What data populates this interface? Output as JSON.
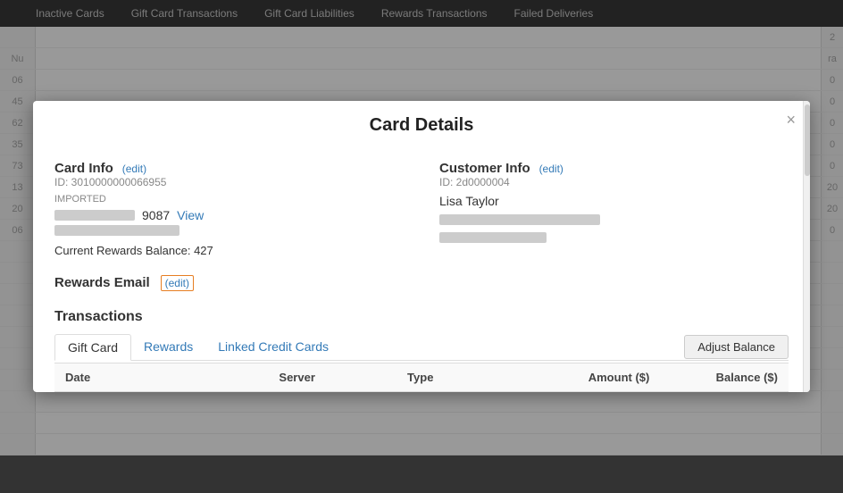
{
  "nav": {
    "items": [
      "Inactive Cards",
      "Gift Card Transactions",
      "Gift Card Liabilities",
      "Rewards Transactions",
      "Failed Deliveries"
    ]
  },
  "modal": {
    "title": "Card Details",
    "close_label": "×",
    "card_info": {
      "section_title": "Card Info",
      "edit_label": "(edit)",
      "id_label": "ID: 3010000000066955",
      "imported_label": "IMPORTED",
      "card_number_end": "9087",
      "view_label": "View",
      "rewards_balance_label": "Current Rewards Balance: 427"
    },
    "customer_info": {
      "section_title": "Customer Info",
      "edit_label": "(edit)",
      "id_label": "ID: 2d0000004",
      "customer_name": "Lisa Taylor"
    },
    "rewards_email": {
      "section_title": "Rewards Email",
      "edit_label": "(edit)"
    },
    "transactions": {
      "section_title": "Transactions",
      "tabs": [
        {
          "label": "Gift Card",
          "type": "gift"
        },
        {
          "label": "Rewards",
          "type": "link"
        },
        {
          "label": "Linked Credit Cards",
          "type": "link"
        }
      ],
      "adjust_balance_label": "Adjust Balance",
      "table_headers": [
        "Date",
        "Server",
        "Type",
        "Amount ($)",
        "Balance ($)"
      ]
    }
  },
  "bg_rows": [
    {
      "num": "",
      "right": "2"
    },
    {
      "num": "Nu",
      "right": "ra"
    },
    {
      "num": "06",
      "right": "0"
    },
    {
      "num": "45",
      "right": "0"
    },
    {
      "num": "62",
      "right": "0"
    },
    {
      "num": "35",
      "right": "0"
    },
    {
      "num": "73",
      "right": "0"
    },
    {
      "num": "13",
      "right": "20"
    },
    {
      "num": "20",
      "right": "20"
    },
    {
      "num": "06",
      "right": "0"
    },
    {
      "num": "",
      "right": ""
    },
    {
      "num": "",
      "right": ""
    },
    {
      "num": "",
      "right": ""
    },
    {
      "num": "",
      "right": ""
    },
    {
      "num": "",
      "right": ""
    },
    {
      "num": "",
      "right": ""
    },
    {
      "num": "",
      "right": ""
    },
    {
      "num": "",
      "right": ""
    },
    {
      "num": "",
      "right": ""
    },
    {
      "num": "",
      "right": ""
    }
  ]
}
